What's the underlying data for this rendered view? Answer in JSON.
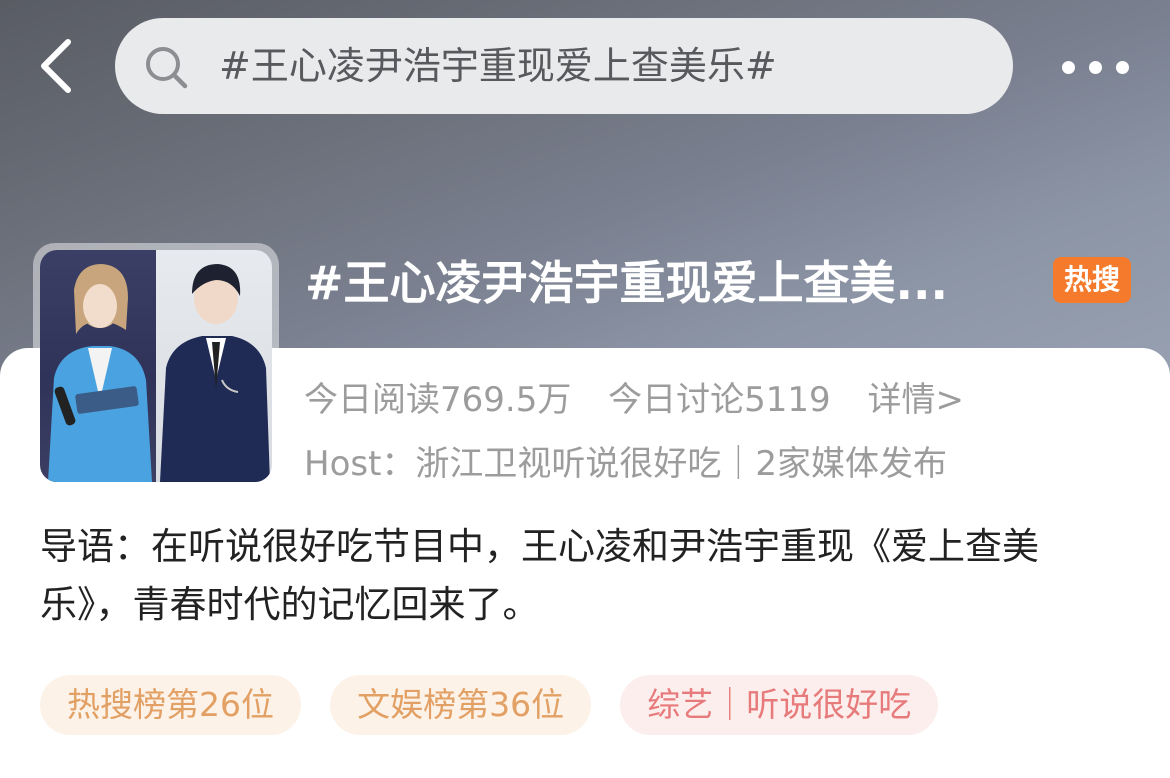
{
  "search": {
    "query": "#王心凌尹浩宇重现爱上查美乐#"
  },
  "icons": {
    "back": "back-arrow-icon",
    "search": "search-icon",
    "more": "more-dots-icon"
  },
  "topic": {
    "title": "#王心凌尹浩宇重现爱上查美...",
    "badge": "热搜",
    "stats": {
      "reads": "今日阅读769.5万",
      "discussions": "今日讨论5119",
      "detail": "详情>"
    },
    "host_line": "Host：浙江卫视听说很好吃｜2家媒体发布",
    "intro": "导语：在听说很好吃节目中，王心凌和尹浩宇重现《爱上查美乐》，青春时代的记忆回来了。"
  },
  "tags": [
    {
      "label": "热搜榜第26位"
    },
    {
      "label": "文娱榜第36位"
    },
    {
      "label": "综艺｜听说很好吃"
    }
  ],
  "colors": {
    "badge": "#f57a2b",
    "tag_orange_bg": "#fdf2e8",
    "tag_orange_text": "#e2a064",
    "tag_red_bg": "#fdeeee",
    "tag_red_text": "#e77a7a"
  }
}
